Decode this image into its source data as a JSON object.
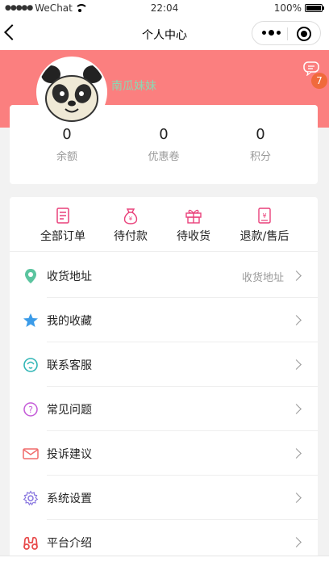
{
  "status_bar": {
    "carrier": "WeChat",
    "time": "22:04",
    "battery": "100%"
  },
  "nav": {
    "title": "个人中心"
  },
  "profile": {
    "username": "南瓜妹妹",
    "message_badge": "7"
  },
  "stats": [
    {
      "value": "0",
      "label": "余额"
    },
    {
      "value": "0",
      "label": "优惠卷"
    },
    {
      "value": "0",
      "label": "积分"
    }
  ],
  "orders": [
    {
      "label": "全部订单",
      "icon": "order-list-icon"
    },
    {
      "label": "待付款",
      "icon": "wallet-icon"
    },
    {
      "label": "待收货",
      "icon": "gift-box-icon"
    },
    {
      "label": "退款/售后",
      "icon": "refund-icon"
    }
  ],
  "menu": [
    {
      "label": "收货地址",
      "extra": "收货地址",
      "icon": "location-icon",
      "color": "#5bc49f"
    },
    {
      "label": "我的收藏",
      "extra": "",
      "icon": "star-icon",
      "color": "#3b9be8"
    },
    {
      "label": "联系客服",
      "extra": "",
      "icon": "customer-service-icon",
      "color": "#31b6b6"
    },
    {
      "label": "常见问题",
      "extra": "",
      "icon": "question-icon",
      "color": "#c45bd8"
    },
    {
      "label": "投诉建议",
      "extra": "",
      "icon": "mail-icon",
      "color": "#f06a6a"
    },
    {
      "label": "系统设置",
      "extra": "",
      "icon": "settings-icon",
      "color": "#8a78e0"
    },
    {
      "label": "平台介绍",
      "extra": "",
      "icon": "binoculars-icon",
      "color": "#e84a4a"
    }
  ],
  "colors": {
    "header": "#fb7f7f",
    "accent_pink": "#e9407a"
  }
}
